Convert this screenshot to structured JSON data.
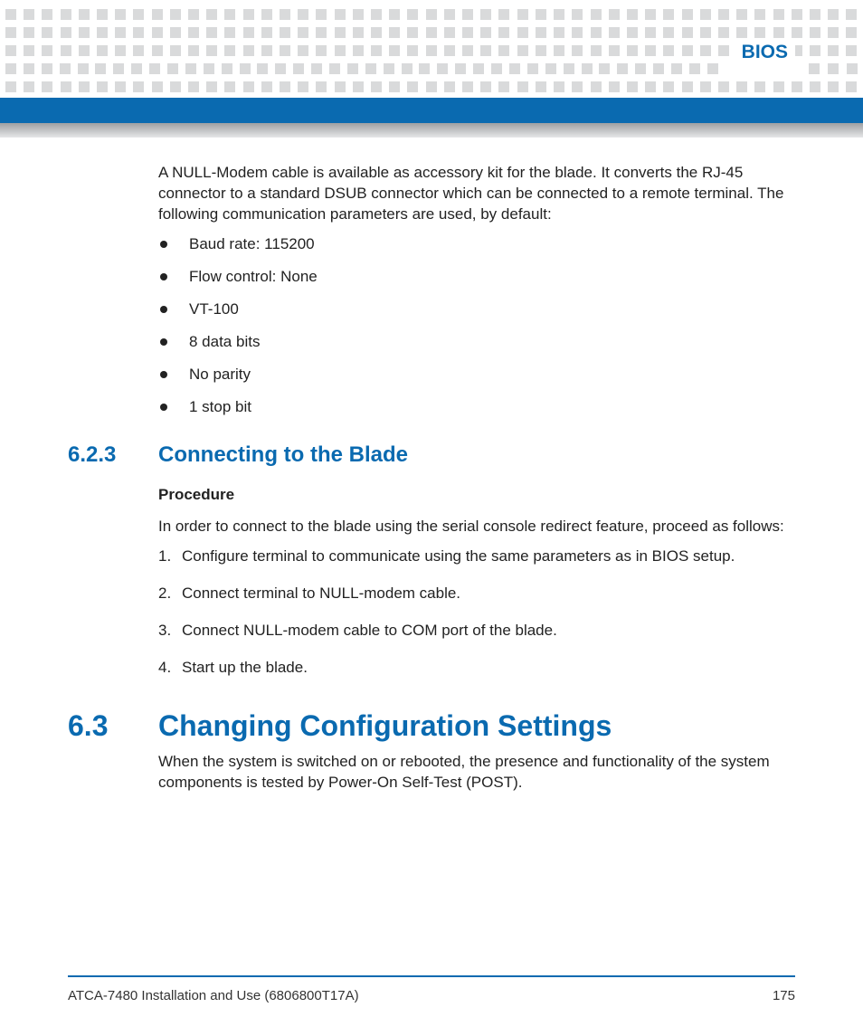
{
  "header": {
    "title": "BIOS"
  },
  "intro_para": "A NULL-Modem cable is available as accessory kit for the blade. It converts the RJ-45 connector to a standard DSUB connector which can be connected to a remote terminal. The following communication parameters are used, by default:",
  "params": [
    "Baud rate: 115200",
    "Flow control: None",
    "VT-100",
    "8 data bits",
    "No parity",
    "1 stop bit"
  ],
  "sec623": {
    "num": "6.2.3",
    "title": "Connecting to the Blade",
    "procedure_label": "Procedure",
    "lead": "In order to connect to the blade using the serial console redirect feature, proceed as follows:",
    "steps": [
      "Configure terminal to communicate using the same parameters as in BIOS setup.",
      "Connect terminal to NULL-modem cable.",
      "Connect NULL-modem cable to COM port of the blade.",
      "Start up the blade."
    ]
  },
  "sec63": {
    "num": "6.3",
    "title": "Changing Configuration Settings",
    "para": "When the system is switched on or rebooted, the presence and functionality of the system components is tested by Power-On Self-Test (POST)."
  },
  "footer": {
    "doc": "ATCA-7480 Installation and Use (6806800T17A)",
    "page": "175"
  }
}
